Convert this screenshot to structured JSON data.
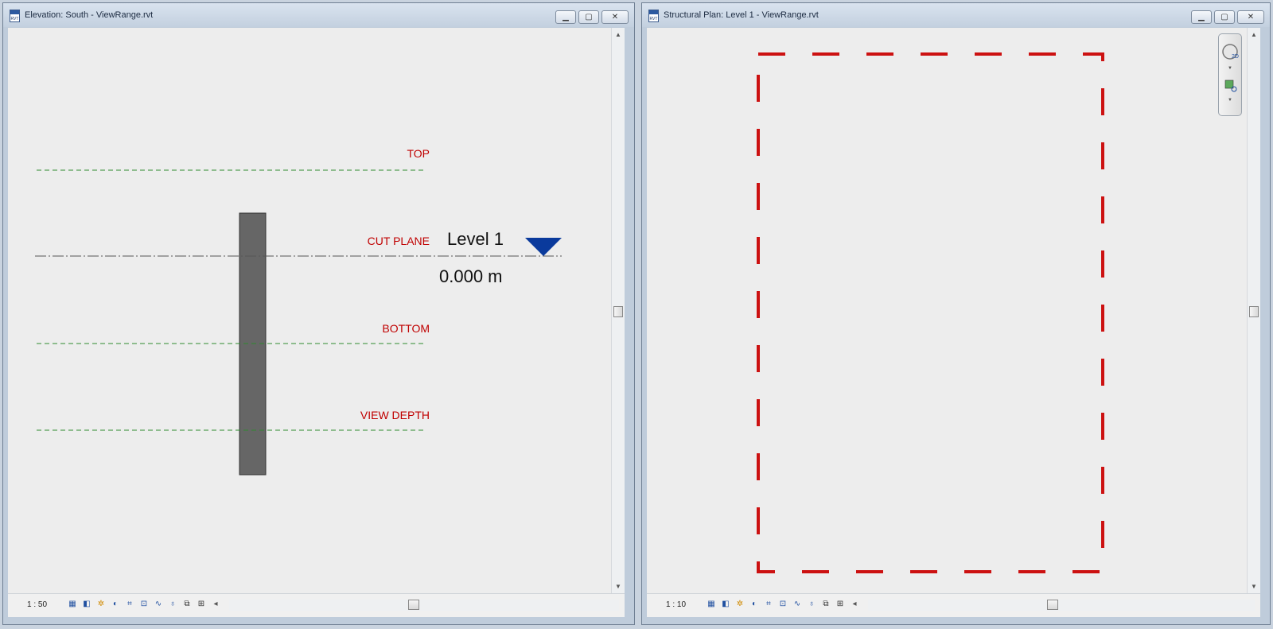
{
  "left_window": {
    "title": "Elevation: South - ViewRange.rvt",
    "controls": {
      "minimize": "▁",
      "restore": "▢",
      "close": "✕"
    },
    "labels": {
      "top": "TOP",
      "cut_plane": "CUT PLANE",
      "bottom": "BOTTOM",
      "view_depth": "VIEW DEPTH"
    },
    "level": {
      "name": "Level 1",
      "elevation": "0.000 m"
    },
    "scale": "1 : 50",
    "colors": {
      "view_range_label": "#c00000",
      "range_line": "#2e8b2e",
      "level_marker": "#0a3a9c",
      "column": "#666666"
    }
  },
  "right_window": {
    "title": "Structural Plan: Level 1 - ViewRange.rvt",
    "controls": {
      "minimize": "▁",
      "restore": "▢",
      "close": "✕"
    },
    "scale": "1 : 10",
    "nav_bar": {
      "wheel_label": "2D"
    },
    "colors": {
      "boundary": "#cc1111"
    }
  },
  "view_control_icons": [
    "detail-level-icon",
    "visual-style-icon",
    "sun-path-icon",
    "shadows-icon",
    "crop-view-icon",
    "show-crop-icon",
    "temporary-hide-icon",
    "reveal-hidden-icon",
    "worksharing-icon",
    "analytical-model-icon"
  ]
}
